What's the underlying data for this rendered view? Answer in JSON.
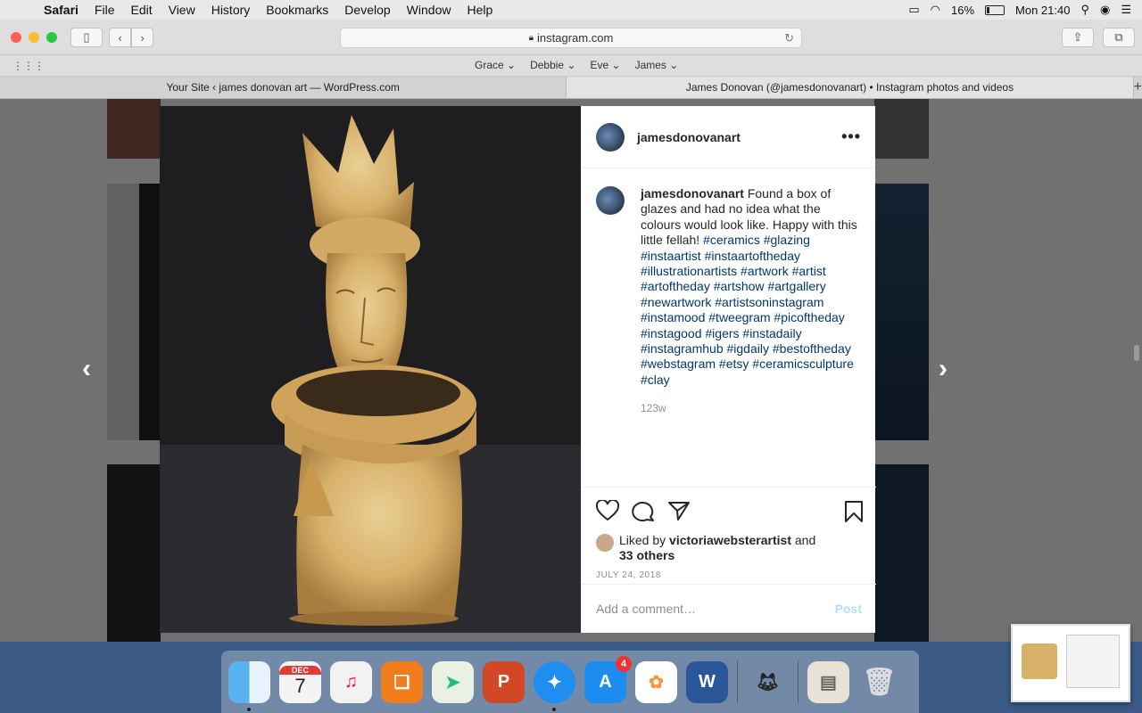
{
  "menubar": {
    "app": "Safari",
    "items": [
      "File",
      "Edit",
      "View",
      "History",
      "Bookmarks",
      "Develop",
      "Window",
      "Help"
    ],
    "battery": "16%",
    "clock": "Mon 21:40"
  },
  "toolbar": {
    "url": "instagram.com"
  },
  "favorites": [
    "Grace",
    "Debbie",
    "Eve",
    "James"
  ],
  "tabs": [
    {
      "title": "Your Site ‹ james donovan art — WordPress.com"
    },
    {
      "title": "James Donovan (@jamesdonovanart) • Instagram photos and videos"
    }
  ],
  "post": {
    "username": "jamesdonovanart",
    "caption_text": "Found a box of glazes and had no idea what the colours would look like. Happy with this little fellah!",
    "hashtags": "#ceramics #glazing #instaartist #instaartoftheday #illustrationartists #artwork #artist #artoftheday #artshow #artgallery #newartwork #artistsoninstagram #instamood #tweegram #picoftheday #instagood #igers #instadaily #instagramhub #igdaily #bestoftheday #webstagram #etsy #ceramicsculpture #clay",
    "age": "123w",
    "liked_prefix": "Liked by",
    "liked_user": "victoriawebsterartist",
    "liked_and": "and",
    "liked_others": "33 others",
    "date": "JULY 24, 2018",
    "comment_placeholder": "Add a comment…",
    "post_label": "Post"
  },
  "dock": {
    "calendar_month": "DEC",
    "calendar_day": "7",
    "appstore_badge": "4"
  }
}
